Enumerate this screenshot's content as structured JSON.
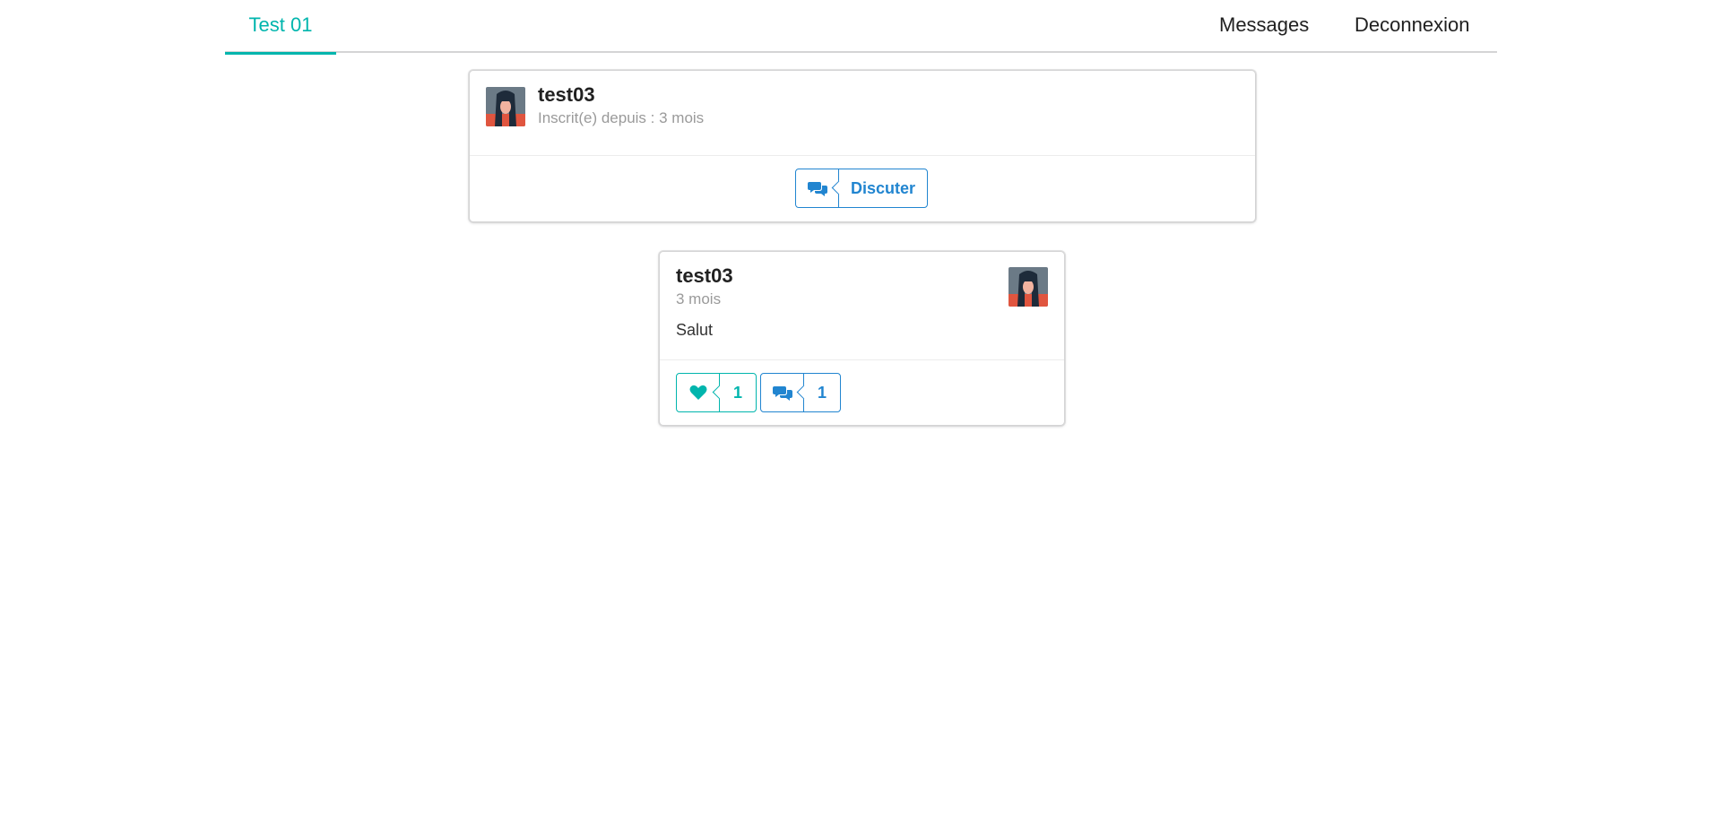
{
  "nav": {
    "brand": "Test 01",
    "messages": "Messages",
    "logout": "Deconnexion"
  },
  "profile_card": {
    "username": "test03",
    "registered": "Inscrit(e) depuis : 3 mois",
    "chat_button": "Discuter",
    "chat_icon": "comments-icon",
    "avatar": "avatar"
  },
  "post_card": {
    "username": "test03",
    "time": "3 mois",
    "content": "Salut",
    "likes": "1",
    "comments": "1",
    "like_icon": "heart-icon",
    "comment_icon": "comments-icon"
  },
  "colors": {
    "accent_teal": "#00b5ad",
    "accent_blue": "#2185d0",
    "text": "#212121",
    "muted": "#9a9a9a"
  }
}
